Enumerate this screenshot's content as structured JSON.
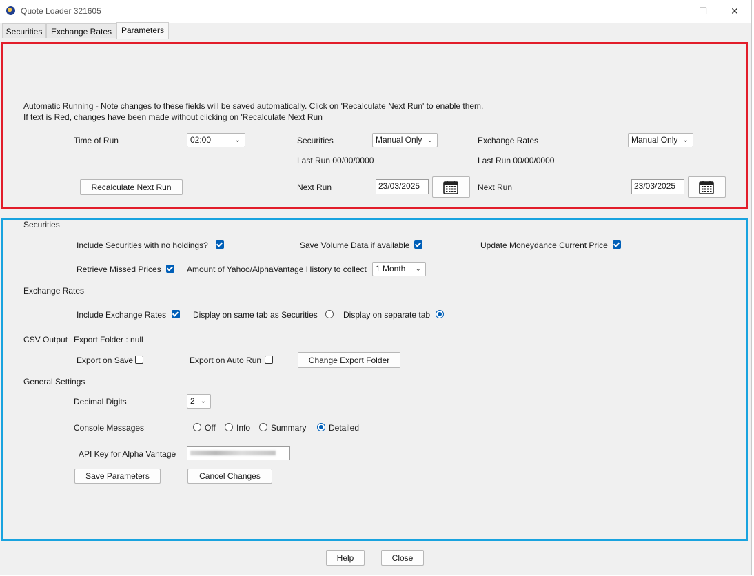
{
  "window": {
    "title": "Quote Loader 321605",
    "controls": [
      "—",
      "☐",
      "✕"
    ]
  },
  "tabs": [
    "Securities",
    "Exchange Rates",
    "Parameters"
  ],
  "auto": {
    "note_line1": "Automatic Running - Note changes to these fields will be saved automatically. Click on 'Recalculate Next Run' to enable them.",
    "note_line2": "If text is Red, changes have been made without clicking on 'Recalculate Next Run",
    "time_label": "Time of Run",
    "time_value": "02:00",
    "securities_label": "Securities",
    "securities_value": "Manual Only",
    "exchange_label": "Exchange Rates",
    "exchange_value": "Manual Only",
    "sec_last_run": "Last Run 00/00/0000",
    "ex_last_run": "Last Run 00/00/0000",
    "recalc_button": "Recalculate Next Run",
    "sec_next_run_label": "Next Run",
    "sec_next_run_value": "23/03/2025",
    "ex_next_run_label": "Next Run",
    "ex_next_run_value": "23/03/2025"
  },
  "securities": {
    "heading": "Securities",
    "include_no_holdings": "Include Securities with no holdings?",
    "include_no_holdings_checked": true,
    "save_volume": "Save Volume Data if available",
    "save_volume_checked": true,
    "update_current_price": "Update Moneydance Current Price",
    "update_current_price_checked": true,
    "retrieve_missed": "Retrieve Missed Prices",
    "retrieve_missed_checked": true,
    "history_label": "Amount of Yahoo/AlphaVantage History to collect",
    "history_value": "1 Month"
  },
  "exchange": {
    "heading": "Exchange Rates",
    "include_label": "Include Exchange Rates",
    "include_checked": true,
    "same_tab_label": "Display on same tab as Securities",
    "separate_tab_label": "Display on separate tab",
    "selected": "separate"
  },
  "csv": {
    "heading": "CSV Output",
    "export_folder": "Export Folder : null",
    "export_on_save": "Export on Save",
    "export_on_save_checked": false,
    "export_on_auto": "Export on Auto Run",
    "export_on_auto_checked": false,
    "change_folder_button": "Change Export Folder"
  },
  "general": {
    "heading": "General Settings",
    "decimal_label": "Decimal Digits",
    "decimal_value": "2",
    "console_label": "Console Messages",
    "console_options": [
      "Off",
      "Info",
      "Summary",
      "Detailed"
    ],
    "console_selected": "Detailed",
    "api_label": "API Key for Alpha Vantage",
    "save_button": "Save Parameters",
    "cancel_button": "Cancel Changes"
  },
  "footer": {
    "help_button": "Help",
    "close_button": "Close"
  },
  "colors": {
    "auto_border": "#e21d2a",
    "params_border": "#19a3df",
    "accent": "#005fb8"
  },
  "icons": {
    "calendar": "calendar-icon",
    "dropdown": "chevron-down-icon",
    "app": "app-logo-icon"
  }
}
